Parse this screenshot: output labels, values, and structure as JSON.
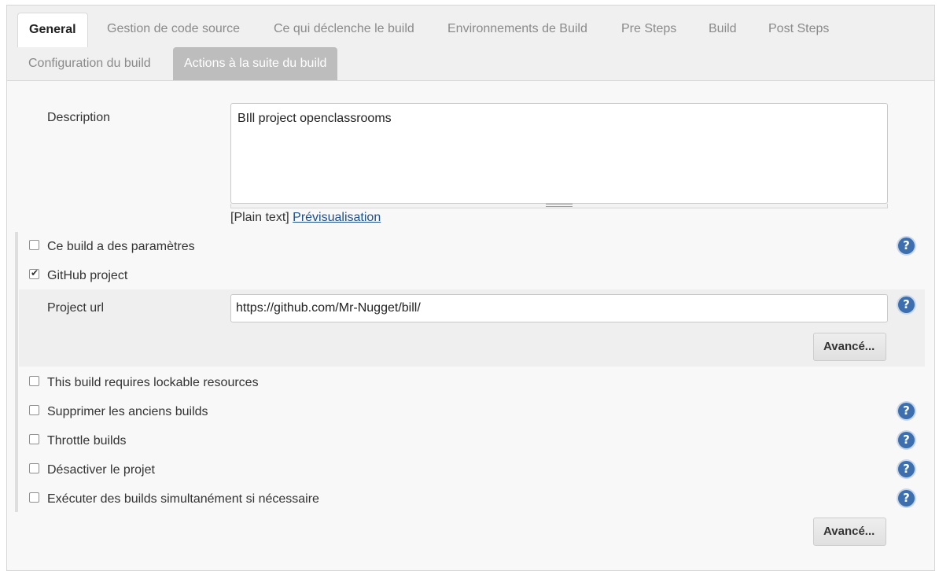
{
  "tabs": [
    {
      "label": "General"
    },
    {
      "label": "Gestion de code source"
    },
    {
      "label": "Ce qui déclenche le build"
    },
    {
      "label": "Environnements de Build"
    },
    {
      "label": "Pre Steps"
    },
    {
      "label": "Build"
    },
    {
      "label": "Post Steps"
    },
    {
      "label": "Configuration du build"
    },
    {
      "label": "Actions à la suite du build"
    }
  ],
  "description": {
    "label": "Description",
    "value": "BIll project openclassrooms",
    "format_text": "[Plain text]",
    "preview_link": "Prévisualisation"
  },
  "options": {
    "params": {
      "label": "Ce build a des paramètres",
      "checked": false
    },
    "github": {
      "label": "GitHub project",
      "checked": true
    },
    "lockable": {
      "label": "This build requires lockable resources",
      "checked": false
    },
    "discard": {
      "label": "Supprimer les anciens builds",
      "checked": false
    },
    "throttle": {
      "label": "Throttle builds",
      "checked": false
    },
    "disable": {
      "label": "Désactiver le projet",
      "checked": false
    },
    "concurrent": {
      "label": "Exécuter des builds simultanément si nécessaire",
      "checked": false
    }
  },
  "github_project": {
    "url_label": "Project url",
    "url_value": "https://github.com/Mr-Nugget/bill/",
    "advanced_label": "Avancé..."
  },
  "advanced_label": "Avancé...",
  "help_glyph": "?",
  "colors": {
    "help_icon": "#3d6fae",
    "link": "#1f4e8c",
    "selected_tab": "#bdbdbd"
  }
}
